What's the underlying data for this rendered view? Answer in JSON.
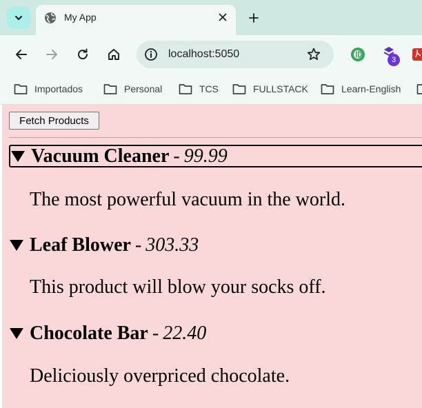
{
  "browser": {
    "tab": {
      "title": "My App",
      "favicon": "globe-icon"
    },
    "url": "localhost:5050",
    "extension_badge": "3",
    "bookmarks": [
      "Importados",
      "Personal",
      "TCS",
      "FULLSTACK",
      "Learn-English"
    ]
  },
  "page": {
    "fetch_label": "Fetch Products",
    "products": [
      {
        "name": "Vacuum Cleaner",
        "separator": "-",
        "price": "99.99",
        "description": "The most powerful vacuum in the world."
      },
      {
        "name": "Leaf Blower",
        "separator": "-",
        "price": "303.33",
        "description": "This product will blow your socks off."
      },
      {
        "name": "Chocolate Bar",
        "separator": "-",
        "price": "22.40",
        "description": "Deliciously overpriced chocolate."
      }
    ]
  },
  "colors": {
    "tabstrip": "#cfe8e2",
    "toolbar": "#f1f8f6",
    "page_background": "#fad8d9",
    "tab_menu_accent": "#a9f0ea"
  }
}
